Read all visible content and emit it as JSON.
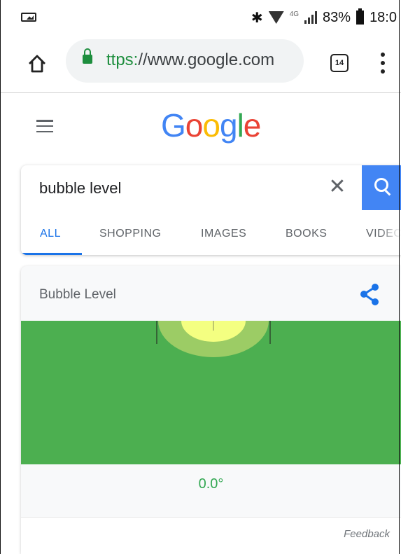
{
  "status_bar": {
    "battery": "83%",
    "time": "18:0",
    "network": "4G"
  },
  "browser": {
    "url_scheme": "ttps:",
    "url_rest": "//www.google.com",
    "tab_count": "14"
  },
  "google": {
    "logo_letters": [
      "G",
      "o",
      "o",
      "g",
      "l",
      "e"
    ]
  },
  "search": {
    "query": "bubble level",
    "tabs": [
      "ALL",
      "SHOPPING",
      "IMAGES",
      "BOOKS",
      "VIDEC"
    ],
    "active_tab": "ALL"
  },
  "bubble_level": {
    "title": "Bubble Level",
    "angle": "0.0°",
    "feedback": "Feedback"
  },
  "colors": {
    "accent_blue": "#4285f4",
    "level_green": "#4caf50",
    "bubble_yellow": "#f4ff81"
  }
}
